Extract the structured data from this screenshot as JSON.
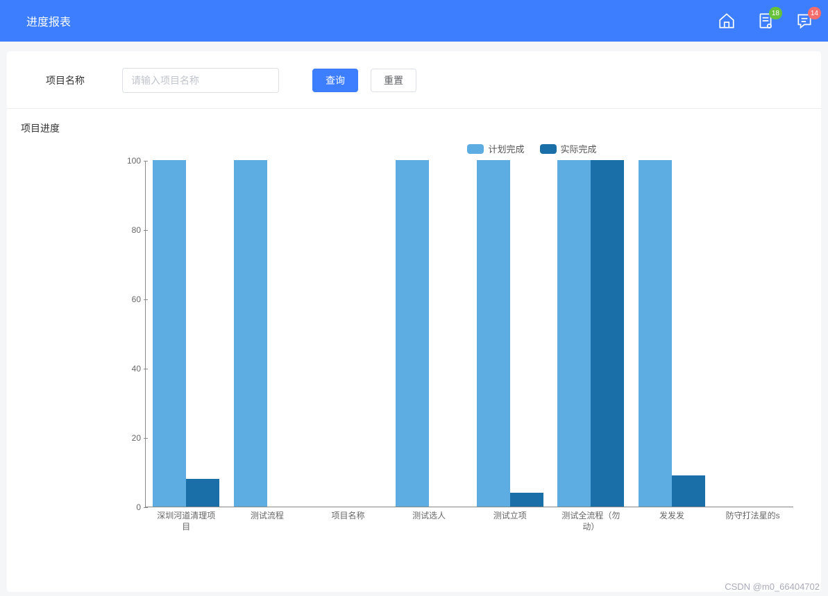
{
  "header": {
    "title": "进度报表",
    "badges": {
      "doc": "18",
      "chat": "14"
    }
  },
  "filter": {
    "label": "项目名称",
    "placeholder": "请输入项目名称",
    "query_btn": "查询",
    "reset_btn": "重置"
  },
  "section": {
    "title": "项目进度"
  },
  "legend": {
    "plan": "计划完成",
    "actual": "实际完成"
  },
  "colors": {
    "plan": "#5dade2",
    "actual": "#1b6fa8"
  },
  "chart_data": {
    "type": "bar",
    "ylim": [
      0,
      100
    ],
    "yticks": [
      0,
      20,
      40,
      60,
      80,
      100
    ],
    "categories": [
      "深圳河道清理项目",
      "测试流程",
      "项目名称",
      "测试选人",
      "测试立项",
      "测试全流程（勿动）",
      "发发发",
      "防守打法星的s"
    ],
    "series": [
      {
        "name": "计划完成",
        "key": "plan",
        "values": [
          100,
          100,
          0,
          100,
          100,
          100,
          100,
          0
        ]
      },
      {
        "name": "实际完成",
        "key": "actual",
        "values": [
          8,
          0,
          0,
          0,
          4,
          100,
          9,
          0
        ]
      }
    ]
  },
  "watermark": "CSDN @m0_66404702"
}
